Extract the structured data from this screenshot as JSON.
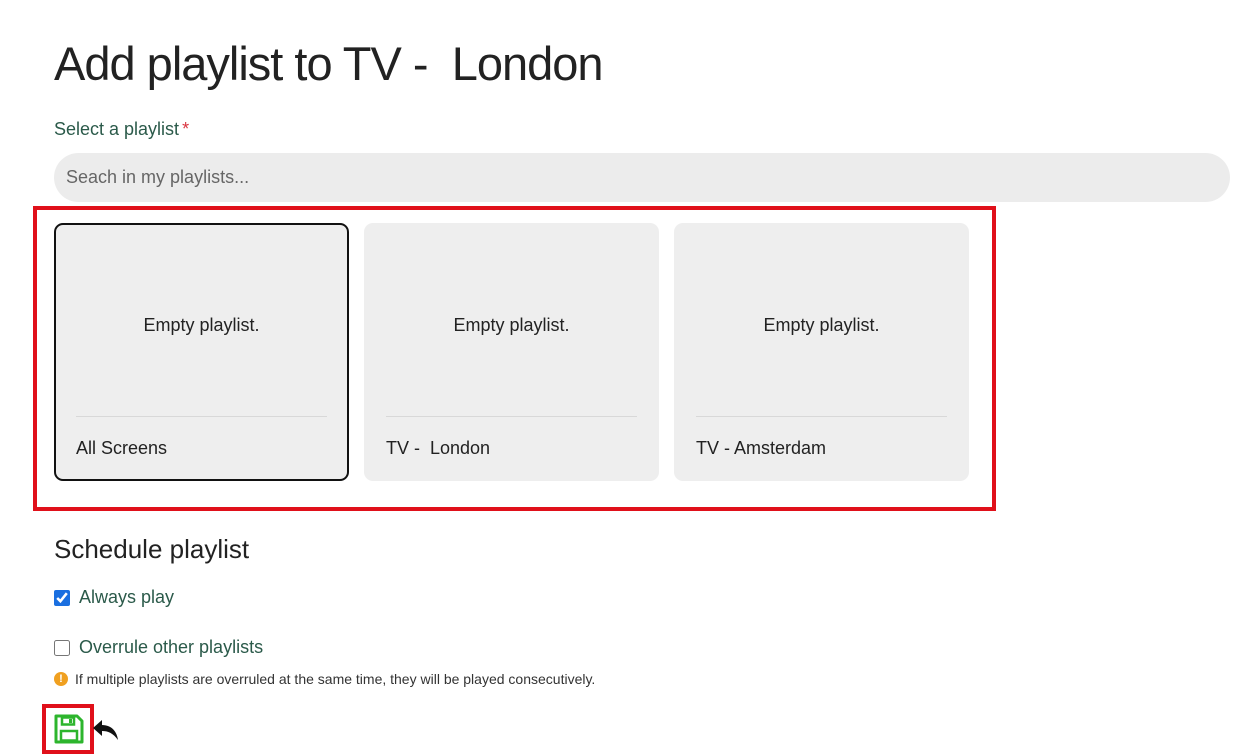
{
  "page": {
    "title": "Add playlist to TV -  London"
  },
  "select": {
    "label": "Select a playlist",
    "required_mark": "*",
    "search_placeholder": "Seach in my playlists..."
  },
  "playlists": [
    {
      "empty_text": "Empty playlist.",
      "name": "All Screens",
      "selected": true
    },
    {
      "empty_text": "Empty playlist.",
      "name": "TV -  London",
      "selected": false
    },
    {
      "empty_text": "Empty playlist.",
      "name": "TV - Amsterdam",
      "selected": false
    }
  ],
  "schedule": {
    "heading": "Schedule playlist",
    "always_play": {
      "label": "Always play",
      "checked": true
    },
    "overrule": {
      "label": "Overrule other playlists",
      "checked": false
    },
    "info_text": "If multiple playlists are overruled at the same time, they will be played consecutively.",
    "info_icon": "!"
  },
  "actions": {
    "save_icon": "floppy-disk-icon",
    "back_icon": "reply-arrow-icon"
  },
  "colors": {
    "highlight": "#e0101a",
    "save_green": "#2db52d",
    "label_green": "#2b5a4a",
    "info_orange": "#f0a020"
  }
}
